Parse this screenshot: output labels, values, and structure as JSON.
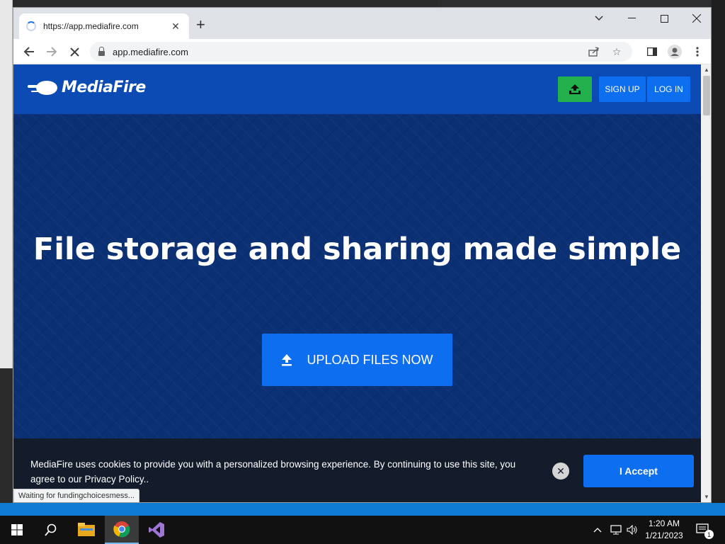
{
  "browser": {
    "tab_title": "https://app.mediafire.com",
    "url": "app.mediafire.com",
    "status_text": "Waiting for fundingchoicesmess..."
  },
  "site": {
    "logo_text": "MediaFire",
    "signup_label": "SIGN UP",
    "login_label": "LOG IN",
    "hero_title": "File storage and sharing made simple",
    "upload_button_label": "UPLOAD FILES NOW"
  },
  "cookie_banner": {
    "text": "MediaFire uses cookies to provide you with a personalized browsing experience. By continuing to use this site, you agree to our Privacy Policy..",
    "accept_label": "I Accept"
  },
  "taskbar": {
    "time": "1:20 AM",
    "date": "1/21/2023",
    "notification_count": "1"
  },
  "colors": {
    "header_blue": "#0b4bb3",
    "page_navy": "#0b3073",
    "button_blue": "#0d6ff0",
    "upload_green": "#22b14c"
  }
}
